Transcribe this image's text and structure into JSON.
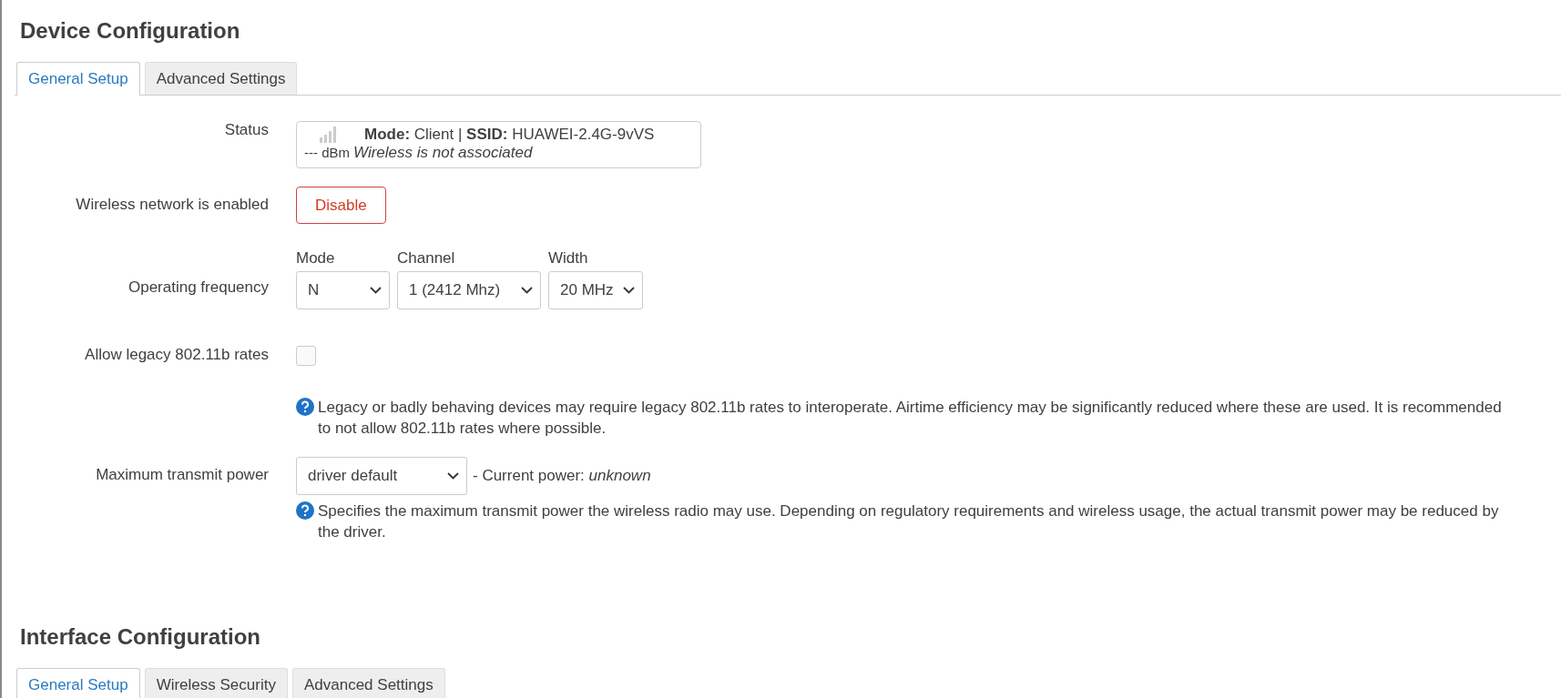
{
  "sections": [
    {
      "title": "Device Configuration",
      "tabs": [
        {
          "label": "General Setup",
          "selected": true
        },
        {
          "label": "Advanced Settings",
          "selected": false
        }
      ],
      "fields": [
        {
          "kind": "status",
          "label": "Status",
          "line": "**Mode:** Client | **SSID:** HUAWEI-2.4G-9vVS",
          "signal": "--- dBm",
          "state": "Wireless is not associated"
        },
        {
          "kind": "button",
          "label": "Wireless network is enabled",
          "button": "Disable"
        },
        {
          "kind": "frequency",
          "label": "Operating frequency",
          "selects": [
            {
              "caption": "Mode",
              "value": "N"
            },
            {
              "caption": "Channel",
              "value": "1 (2412 Mhz)"
            },
            {
              "caption": "Width",
              "value": "20 MHz"
            }
          ]
        },
        {
          "kind": "checkbox",
          "label": "Allow legacy 802.11b rates",
          "checked": false,
          "help": "Legacy or badly behaving devices may require legacy 802.11b rates to interoperate. Airtime efficiency may be significantly reduced where these are used. It is recommended to not allow 802.11b rates where possible."
        },
        {
          "kind": "select",
          "label": "Maximum transmit power",
          "value": "driver default",
          "note": "- Current power: *unknown*",
          "help": "Specifies the maximum transmit power the wireless radio may use. Depending on regulatory requirements and wireless usage, the actual transmit power may be reduced by the driver."
        }
      ]
    },
    {
      "title": "Interface Configuration",
      "tabs": [
        {
          "label": "General Setup",
          "selected": true
        },
        {
          "label": "Wireless Security",
          "selected": false
        },
        {
          "label": "Advanced Settings",
          "selected": false
        }
      ]
    }
  ]
}
